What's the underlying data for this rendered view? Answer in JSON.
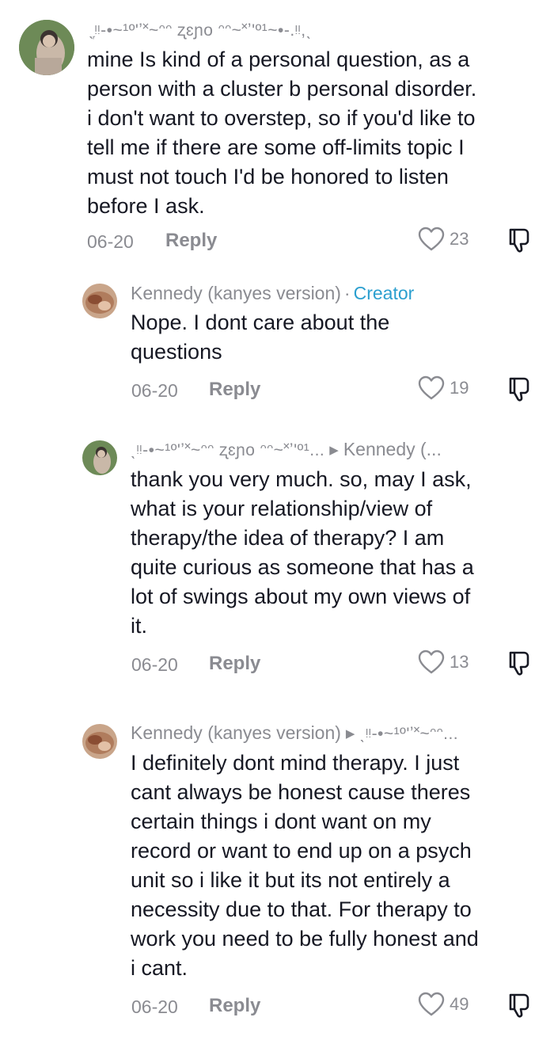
{
  "colors": {
    "text": "#161823",
    "muted": "#8a8b91",
    "creator": "#2b9fcf"
  },
  "comments": [
    {
      "username": "ˎ᷊ᵎᵎ-•~¹º'ʼ˟~ᵔᵔ  ʐɛɲo ᵔᵔ~˟ʼ'º¹~•-.ᵎᵎ,ˎ",
      "text": "mine Is kind of a personal question, as a\nperson with a cluster b personal disorder.\ni don't want to overstep, so if you'd like to\ntell me if there are some off-limits topic I\nmust not touch I'd be honored to listen\nbefore I ask.",
      "date": "06-20",
      "reply": "Reply",
      "likes": "23"
    },
    {
      "username": "Kennedy (kanyes version)",
      "separator": "·",
      "badge": "Creator",
      "text": "Nope. I dont care about the\nquestions",
      "date": "06-20",
      "reply": "Reply",
      "likes": "19"
    },
    {
      "username": "ˎᵎᵎ-•~¹º'ʼ˟~ᵔᵔ  ʐɛɲo ᵔᵔ~˟ʼ'º¹...",
      "reply_to": "Kennedy (...",
      "text": "thank you very much. so, may I ask,\nwhat is your relationship/view of\ntherapy/the idea of therapy? I am\nquite curious as someone that has a\nlot of swings about my own views of\nit.",
      "date": "06-20",
      "reply": "Reply",
      "likes": "13"
    },
    {
      "username": "Kennedy (kanyes version)",
      "reply_to": "ˎᵎᵎ-•~¹º'ʼ˟~ᵔᵔ...",
      "text": "I definitely dont mind therapy. I just\ncant always be honest cause theres\ncertain things i dont want on my\nrecord or want to end up on a psych\nunit so i like it but its not entirely a\nnecessity due to that. For therapy to\nwork you need to be fully honest and\ni cant.",
      "date": "06-20",
      "reply": "Reply",
      "likes": "49"
    }
  ]
}
